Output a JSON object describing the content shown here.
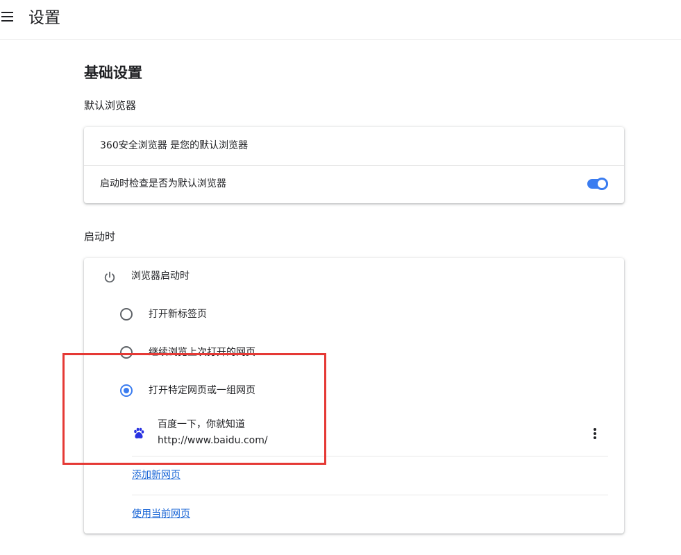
{
  "header": {
    "title": "设置",
    "menu_icon": "menu-icon"
  },
  "basic": {
    "title": "基础设置",
    "default_browser": {
      "heading": "默认浏览器",
      "status_text": "360安全浏览器 是您的默认浏览器",
      "check_label": "启动时检查是否为默认浏览器",
      "check_enabled": true
    }
  },
  "startup": {
    "heading": "启动时",
    "group_label": "浏览器启动时",
    "group_icon": "power-icon",
    "options": [
      {
        "label": "打开新标签页",
        "checked": false
      },
      {
        "label": "继续浏览上次打开的网页",
        "checked": false
      },
      {
        "label": "打开特定网页或一组网页",
        "checked": true
      }
    ],
    "pages": [
      {
        "title": "百度一下，你就知道",
        "url": "http://www.baidu.com/",
        "icon": "baidu-paw-icon"
      }
    ],
    "add_page_link": "添加新网页",
    "use_current_link": "使用当前网页"
  },
  "colors": {
    "accent": "#3a7cf0",
    "link": "#1a66d6",
    "annotation": "#e53935"
  }
}
